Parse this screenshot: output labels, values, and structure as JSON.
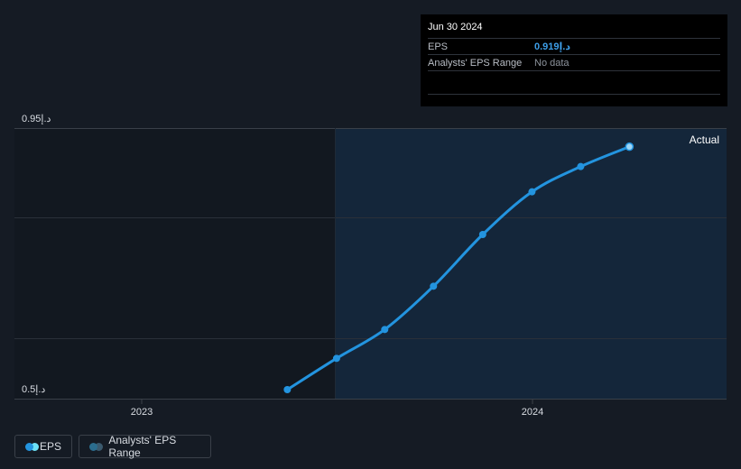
{
  "tooltip": {
    "date": "Jun 30 2024",
    "rows": [
      {
        "label": "EPS",
        "value": "0.919د.إ"
      },
      {
        "label": "Analysts' EPS Range",
        "value": "No data"
      }
    ]
  },
  "annotation": "Actual",
  "legend": [
    {
      "label": "EPS",
      "colors": [
        "#2394df",
        "#6de2f7"
      ]
    },
    {
      "label": "Analysts' EPS Range",
      "colors": [
        "#2b6d8e",
        "#3b5a6e"
      ]
    }
  ],
  "colors": {
    "line": "#2394df",
    "forecast_bg": "#14263a",
    "past_bg": "#121820"
  },
  "chart_data": {
    "type": "line",
    "y_tick_labels": [
      "0.95د.إ",
      "0.5د.إ"
    ],
    "x_tick_labels": [
      "2023",
      "2024"
    ],
    "ylim": [
      0.5,
      0.95
    ],
    "grid": true,
    "series": [
      {
        "name": "EPS",
        "points": [
          {
            "x": "2022-09-30",
            "y": 0.515
          },
          {
            "x": "2022-12-31",
            "y": 0.567
          },
          {
            "x": "2023-03-31",
            "y": 0.615
          },
          {
            "x": "2023-06-30",
            "y": 0.687
          },
          {
            "x": "2023-09-30",
            "y": 0.773
          },
          {
            "x": "2023-12-31",
            "y": 0.844
          },
          {
            "x": "2024-03-31",
            "y": 0.886
          },
          {
            "x": "2024-06-30",
            "y": 0.919
          }
        ]
      }
    ]
  }
}
